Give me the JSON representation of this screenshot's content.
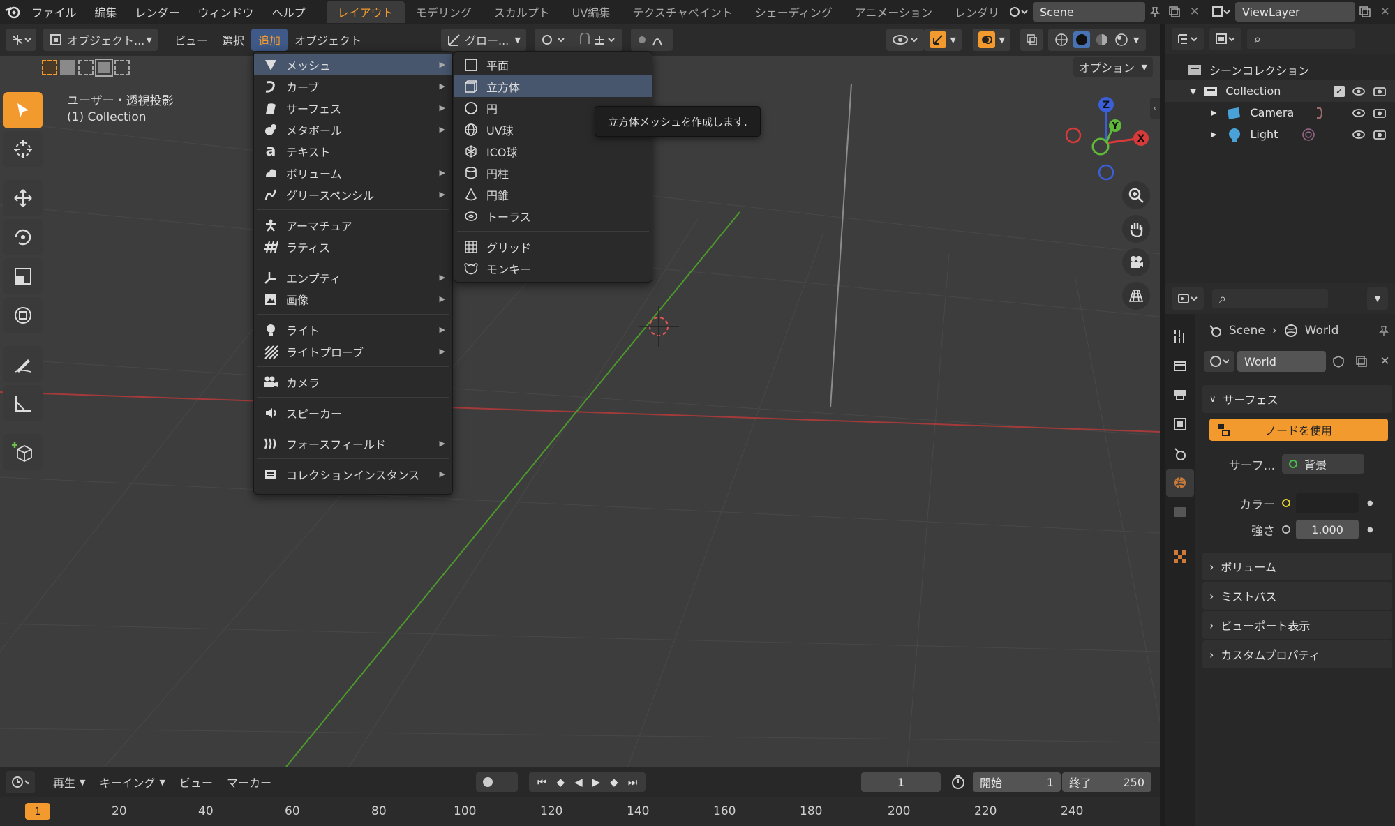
{
  "topmenu": [
    "ファイル",
    "編集",
    "レンダー",
    "ウィンドウ",
    "ヘルプ"
  ],
  "workspaces": [
    "レイアウト",
    "モデリング",
    "スカルプト",
    "UV編集",
    "テクスチャペイント",
    "シェーディング",
    "アニメーション",
    "レンダリ"
  ],
  "scene_name": "Scene",
  "viewlayer_name": "ViewLayer",
  "viewport": {
    "mode": "オブジェクト...",
    "menus": [
      "ビュー",
      "選択",
      "追加",
      "オブジェクト"
    ],
    "transform": "グロー...",
    "options": "オプション",
    "view_label": "ユーザー・透視投影",
    "collection_label": "(1) Collection"
  },
  "add_menu": {
    "items": [
      {
        "label": "メッシュ",
        "icon": "mesh-icon",
        "sub": true
      },
      {
        "label": "カーブ",
        "icon": "curve-icon",
        "sub": true
      },
      {
        "label": "サーフェス",
        "icon": "surface-icon",
        "sub": true
      },
      {
        "label": "メタボール",
        "icon": "metaball-icon",
        "sub": true
      },
      {
        "label": "テキスト",
        "icon": "text-icon",
        "sub": false
      },
      {
        "label": "ボリューム",
        "icon": "volume-icon",
        "sub": true
      },
      {
        "label": "グリースペンシル",
        "icon": "grease-pencil-icon",
        "sub": true
      },
      {
        "label": "アーマチュア",
        "icon": "armature-icon",
        "sub": false
      },
      {
        "label": "ラティス",
        "icon": "lattice-icon",
        "sub": false
      },
      {
        "label": "エンプティ",
        "icon": "empty-icon",
        "sub": true
      },
      {
        "label": "画像",
        "icon": "image-icon",
        "sub": true
      },
      {
        "label": "ライト",
        "icon": "light-icon",
        "sub": true
      },
      {
        "label": "ライトプローブ",
        "icon": "light-probe-icon",
        "sub": true
      },
      {
        "label": "カメラ",
        "icon": "camera-icon",
        "sub": false
      },
      {
        "label": "スピーカー",
        "icon": "speaker-icon",
        "sub": false
      },
      {
        "label": "フォースフィールド",
        "icon": "force-field-icon",
        "sub": true
      },
      {
        "label": "コレクションインスタンス",
        "icon": "collection-instance-icon",
        "sub": true
      }
    ]
  },
  "mesh_menu": {
    "items": [
      {
        "label": "平面",
        "icon": "plane-icon"
      },
      {
        "label": "立方体",
        "icon": "cube-icon"
      },
      {
        "label": "円",
        "icon": "circle-icon"
      },
      {
        "label": "UV球",
        "icon": "uv-sphere-icon"
      },
      {
        "label": "ICO球",
        "icon": "ico-sphere-icon"
      },
      {
        "label": "円柱",
        "icon": "cylinder-icon"
      },
      {
        "label": "円錐",
        "icon": "cone-icon"
      },
      {
        "label": "トーラス",
        "icon": "torus-icon"
      },
      {
        "label": "グリッド",
        "icon": "grid-icon"
      },
      {
        "label": "モンキー",
        "icon": "monkey-icon"
      }
    ]
  },
  "tooltip": "立方体メッシュを作成します.",
  "gizmo": {
    "x": "X",
    "y": "Y",
    "z": "Z"
  },
  "outliner": {
    "root": "シーンコレクション",
    "collection": "Collection",
    "items": [
      "Camera",
      "Light"
    ]
  },
  "properties": {
    "breadcrumb_scene": "Scene",
    "breadcrumb_world": "World",
    "world_name": "World",
    "surface_header": "サーフェス",
    "use_nodes": "ノードを使用",
    "surface_label": "サーフ...",
    "surface_value": "背景",
    "color_label": "カラー",
    "strength_label": "強さ",
    "strength_value": "1.000",
    "volume_header": "ボリューム",
    "mist_header": "ミストパス",
    "viewport_display_header": "ビューポート表示",
    "custom_props_header": "カスタムプロパティ"
  },
  "timeline": {
    "menus": [
      "再生",
      "キーイング",
      "ビュー",
      "マーカー"
    ],
    "current_frame": "1",
    "start_label": "開始",
    "start_value": "1",
    "end_label": "終了",
    "end_value": "250",
    "ruler_current": "1",
    "ruler_ticks": [
      "20",
      "40",
      "60",
      "80",
      "100",
      "120",
      "140",
      "160",
      "180",
      "200",
      "220",
      "240"
    ]
  },
  "colors": {
    "accent": "#f29a2e",
    "x_axis": "#d83a3a",
    "y_axis": "#5fb83a",
    "z_axis": "#3a5fd8",
    "highlight": "#47566d"
  }
}
